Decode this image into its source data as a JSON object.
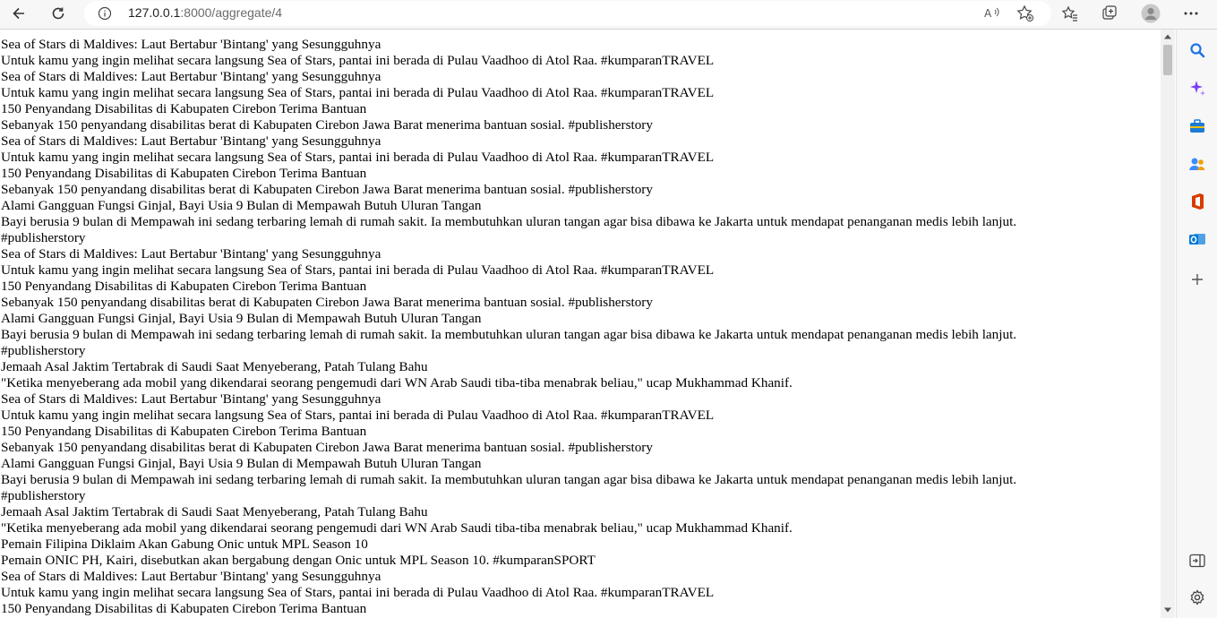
{
  "browser": {
    "url_host": "127.0.0.1",
    "url_rest": ":8000/aggregate/4",
    "icons": [
      "back-icon",
      "reload-icon",
      "info-icon",
      "read-aloud-icon",
      "add-favorite-icon",
      "favorites-icon",
      "collections-icon",
      "profile-icon",
      "more-icon"
    ]
  },
  "sidebar": {
    "icons": [
      "search-icon",
      "copilot-icon",
      "tools-icon",
      "games-icon",
      "office-icon",
      "outlook-icon",
      "add-icon",
      "panel-toggle-icon",
      "settings-icon"
    ],
    "colors": {
      "search": "#1a73e8",
      "copilot": "#7b3ff2",
      "office": "#d83b01",
      "outlook": "#0078d4"
    }
  },
  "feed": [
    "Sea of Stars di Maldives: Laut Bertabur 'Bintang' yang Sesungguhnya",
    "Untuk kamu yang ingin melihat secara langsung Sea of Stars, pantai ini berada di Pulau Vaadhoo di Atol Raa. #kumparanTRAVEL",
    "Sea of Stars di Maldives: Laut Bertabur 'Bintang' yang Sesungguhnya",
    "Untuk kamu yang ingin melihat secara langsung Sea of Stars, pantai ini berada di Pulau Vaadhoo di Atol Raa. #kumparanTRAVEL",
    "150 Penyandang Disabilitas di Kabupaten Cirebon Terima Bantuan",
    "Sebanyak 150 penyandang disabilitas berat di Kabupaten Cirebon Jawa Barat menerima bantuan sosial. #publisherstory",
    "Sea of Stars di Maldives: Laut Bertabur 'Bintang' yang Sesungguhnya",
    "Untuk kamu yang ingin melihat secara langsung Sea of Stars, pantai ini berada di Pulau Vaadhoo di Atol Raa. #kumparanTRAVEL",
    "150 Penyandang Disabilitas di Kabupaten Cirebon Terima Bantuan",
    "Sebanyak 150 penyandang disabilitas berat di Kabupaten Cirebon Jawa Barat menerima bantuan sosial. #publisherstory",
    "Alami Gangguan Fungsi Ginjal, Bayi Usia 9 Bulan di Mempawah Butuh Uluran Tangan",
    "Bayi berusia 9 bulan di Mempawah ini sedang terbaring lemah di rumah sakit. Ia membutuhkan uluran tangan agar bisa dibawa ke Jakarta untuk mendapat penanganan medis lebih lanjut.",
    "#publisherstory",
    "Sea of Stars di Maldives: Laut Bertabur 'Bintang' yang Sesungguhnya",
    "Untuk kamu yang ingin melihat secara langsung Sea of Stars, pantai ini berada di Pulau Vaadhoo di Atol Raa. #kumparanTRAVEL",
    "150 Penyandang Disabilitas di Kabupaten Cirebon Terima Bantuan",
    "Sebanyak 150 penyandang disabilitas berat di Kabupaten Cirebon Jawa Barat menerima bantuan sosial. #publisherstory",
    "Alami Gangguan Fungsi Ginjal, Bayi Usia 9 Bulan di Mempawah Butuh Uluran Tangan",
    "Bayi berusia 9 bulan di Mempawah ini sedang terbaring lemah di rumah sakit. Ia membutuhkan uluran tangan agar bisa dibawa ke Jakarta untuk mendapat penanganan medis lebih lanjut.",
    "#publisherstory",
    "Jemaah Asal Jaktim Tertabrak di Saudi Saat Menyeberang, Patah Tulang Bahu",
    "\"Ketika menyeberang ada mobil yang dikendarai seorang pengemudi dari WN Arab Saudi tiba-tiba menabrak beliau,\" ucap Mukhammad Khanif.",
    "Sea of Stars di Maldives: Laut Bertabur 'Bintang' yang Sesungguhnya",
    "Untuk kamu yang ingin melihat secara langsung Sea of Stars, pantai ini berada di Pulau Vaadhoo di Atol Raa. #kumparanTRAVEL",
    "150 Penyandang Disabilitas di Kabupaten Cirebon Terima Bantuan",
    "Sebanyak 150 penyandang disabilitas berat di Kabupaten Cirebon Jawa Barat menerima bantuan sosial. #publisherstory",
    "Alami Gangguan Fungsi Ginjal, Bayi Usia 9 Bulan di Mempawah Butuh Uluran Tangan",
    "Bayi berusia 9 bulan di Mempawah ini sedang terbaring lemah di rumah sakit. Ia membutuhkan uluran tangan agar bisa dibawa ke Jakarta untuk mendapat penanganan medis lebih lanjut.",
    "#publisherstory",
    "Jemaah Asal Jaktim Tertabrak di Saudi Saat Menyeberang, Patah Tulang Bahu",
    "\"Ketika menyeberang ada mobil yang dikendarai seorang pengemudi dari WN Arab Saudi tiba-tiba menabrak beliau,\" ucap Mukhammad Khanif.",
    "Pemain Filipina Diklaim Akan Gabung Onic untuk MPL Season 10",
    "Pemain ONIC PH, Kairi, disebutkan akan bergabung dengan Onic untuk MPL Season 10. #kumparanSPORT",
    "Sea of Stars di Maldives: Laut Bertabur 'Bintang' yang Sesungguhnya",
    "Untuk kamu yang ingin melihat secara langsung Sea of Stars, pantai ini berada di Pulau Vaadhoo di Atol Raa. #kumparanTRAVEL",
    "150 Penyandang Disabilitas di Kabupaten Cirebon Terima Bantuan"
  ]
}
